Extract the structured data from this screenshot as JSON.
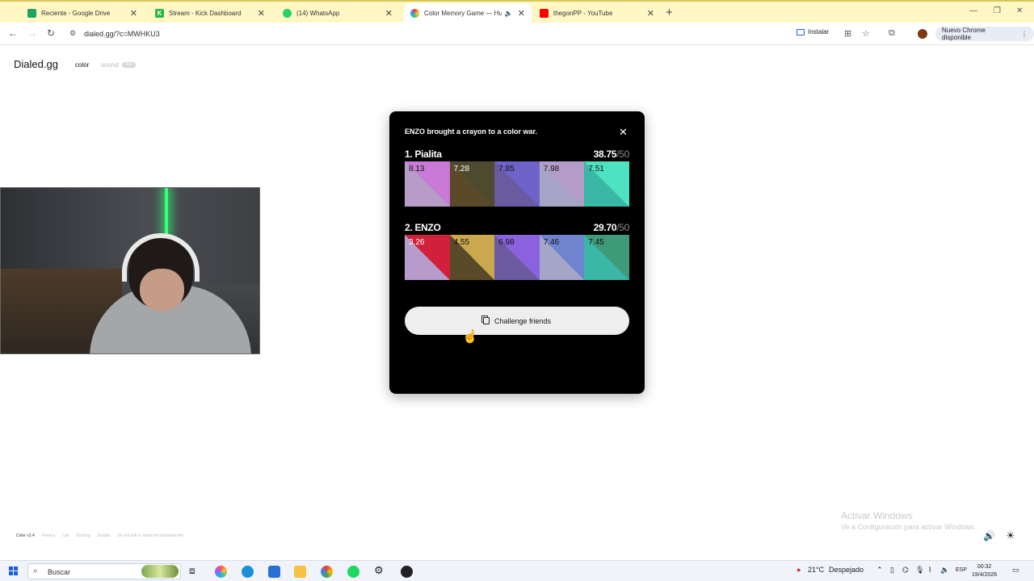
{
  "browser": {
    "tabs": [
      {
        "title": "Reciente - Google Drive",
        "favicon_color": "#1fa463"
      },
      {
        "title": "Stream - Kick Dashboard",
        "favicon_color": "#2ab540",
        "favicon_letter": "K"
      },
      {
        "title": "(14) WhatsApp",
        "favicon_color": "#25d366"
      },
      {
        "title": "Color Memory Game — Hu",
        "favicon_color": "#e44"
      },
      {
        "title": "thegonPP - YouTube",
        "favicon_color": "#ff0000"
      }
    ],
    "url": "dialed.gg/?c=MWHKU3",
    "install_label": "Instalar",
    "update_label": "Nuevo Chrome disponible"
  },
  "page": {
    "brand": "Dialed.gg",
    "nav_color": "color",
    "nav_sound": "sound",
    "nav_badge": "new"
  },
  "modal": {
    "title": "ENZO brought a crayon to a color war.",
    "players": [
      {
        "name": "1. Pialita",
        "score": "38.75",
        "max": "/50",
        "swatches": [
          {
            "value": "8.13",
            "a": "#c97ad6",
            "b": "#b89cc8",
            "text": "#111111"
          },
          {
            "value": "7.28",
            "a": "#4e4a2e",
            "b": "#5a4a2a",
            "text": "#ffffff"
          },
          {
            "value": "7.85",
            "a": "#6f62c9",
            "b": "#6a5aa0",
            "text": "#111111"
          },
          {
            "value": "7.98",
            "a": "#b49cc8",
            "b": "#a8a4c8",
            "text": "#111111"
          },
          {
            "value": "7.51",
            "a": "#4de3c0",
            "b": "#3ab7a6",
            "text": "#111111"
          }
        ]
      },
      {
        "name": "2. ENZO",
        "score": "29.70",
        "max": "/50",
        "swatches": [
          {
            "value": "3.26",
            "a": "#d0203c",
            "b": "#b79ccb",
            "text": "#ffffff"
          },
          {
            "value": "4.55",
            "a": "#c9a84e",
            "b": "#5a4a2a",
            "text": "#111111"
          },
          {
            "value": "6.98",
            "a": "#8a62de",
            "b": "#6a5aa0",
            "text": "#111111"
          },
          {
            "value": "7.46",
            "a": "#6f83cf",
            "b": "#a4a6c8",
            "text": "#111111"
          },
          {
            "value": "7.45",
            "a": "#3f9a7a",
            "b": "#3ab7a6",
            "text": "#111111"
          }
        ]
      }
    ],
    "challenge_label": "Challenge friends"
  },
  "footer": {
    "links": [
      "Color v1.4",
      "Privacy",
      "Lab",
      "Scoring",
      "Socials",
      "Do not sell or share my personal info"
    ]
  },
  "windows": {
    "activate_title": "Activar Windows",
    "activate_sub": "Ve a Configuración para activar Windows.",
    "search_placeholder": "Buscar",
    "weather": "21°C",
    "weather_desc": "Despejado",
    "lang": "ESP",
    "time": "00:32",
    "date": "19/4/2026"
  }
}
